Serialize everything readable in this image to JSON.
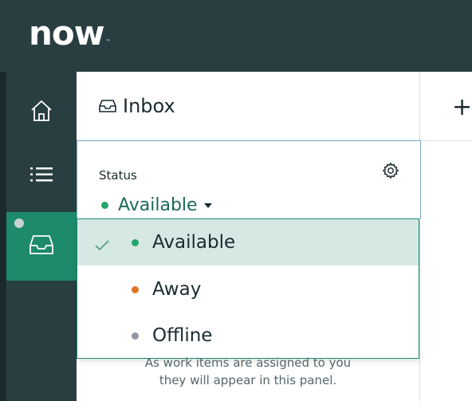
{
  "brand": {
    "logo_text": "now",
    "trademark": "™"
  },
  "colors": {
    "topbar": "#293e40",
    "active_nav": "#1d8a6b",
    "available": "#27a66a",
    "away": "#e37222",
    "offline": "#8f9a9e"
  },
  "left_nav": {
    "items": [
      {
        "icon": "home-icon"
      },
      {
        "icon": "list-icon"
      },
      {
        "icon": "inbox-icon",
        "active": true
      }
    ]
  },
  "panel": {
    "title": "Inbox",
    "title_icon": "inbox-icon"
  },
  "toolbar": {
    "add_icon": "plus-icon",
    "add_label": "+"
  },
  "status": {
    "label": "Status",
    "current": "Available",
    "settings_icon": "gear-icon"
  },
  "dropdown": {
    "options": [
      {
        "label": "Available",
        "color": "#27a66a",
        "selected": true
      },
      {
        "label": "Away",
        "color": "#e37222",
        "selected": false
      },
      {
        "label": "Offline",
        "color": "#8f9a9e",
        "selected": false
      }
    ]
  },
  "empty_state": {
    "line1": "As work items are assigned to you",
    "line2": "they will appear in this panel."
  }
}
